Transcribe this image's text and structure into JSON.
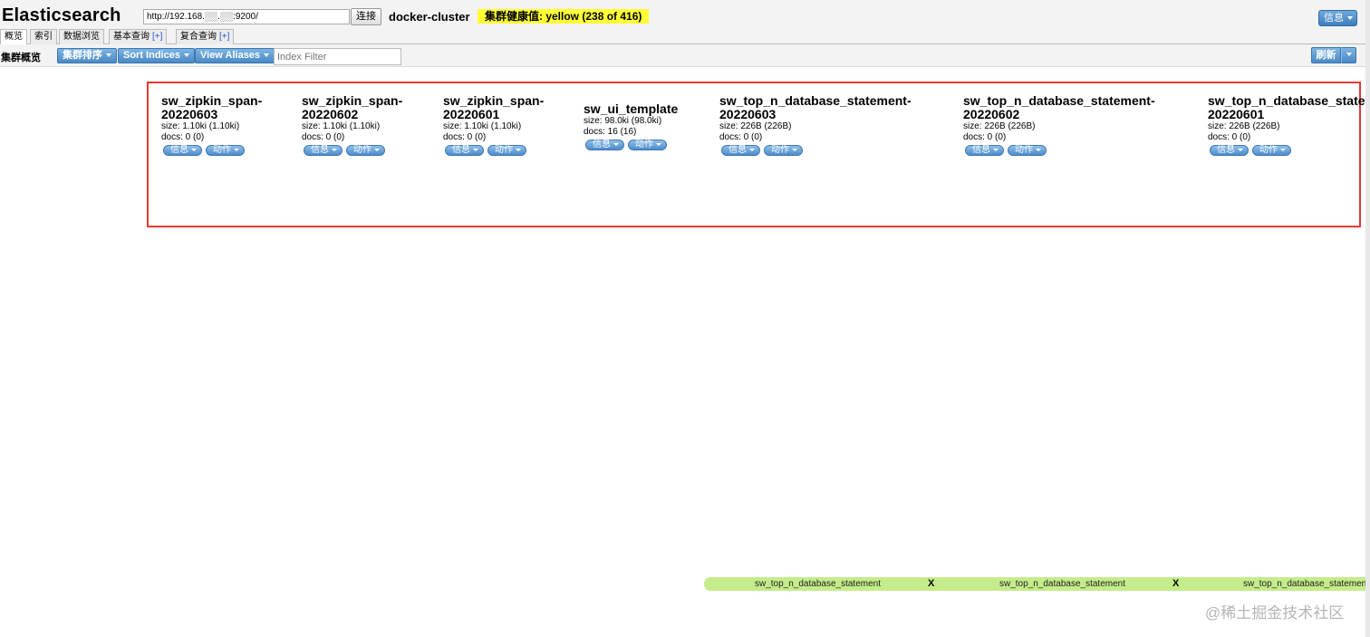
{
  "header": {
    "title": "Elasticsearch",
    "connect_url": "http://192.168.░░.░░:9200/",
    "connect_label": "连接",
    "cluster_name": "docker-cluster",
    "health": "集群健康值: yellow (238 of 416)",
    "info_label": "信息"
  },
  "tabs": [
    {
      "label": "概览",
      "active": true
    },
    {
      "label": "索引"
    },
    {
      "label": "数据浏览"
    },
    {
      "label": "基本查询",
      "plus": "[+]"
    },
    {
      "label": "复合查询",
      "plus": "[+]"
    }
  ],
  "toolbar": {
    "label": "集群概览",
    "sort_cluster": "集群排序",
    "sort_indices": "Sort Indices",
    "view_aliases": "View Aliases",
    "filter_placeholder": "Index Filter",
    "refresh": "刷新"
  },
  "indices": [
    {
      "line1": "sw_zipkin_span-",
      "line2": "20220603",
      "size": "size: 1.10ki (1.10ki)",
      "docs": "docs: 0 (0)",
      "info": "信息",
      "action": "动作"
    },
    {
      "line1": "sw_zipkin_span-",
      "line2": "20220602",
      "size": "size: 1.10ki (1.10ki)",
      "docs": "docs: 0 (0)",
      "info": "信息",
      "action": "动作"
    },
    {
      "line1": "sw_zipkin_span-",
      "line2": "20220601",
      "size": "size: 1.10ki (1.10ki)",
      "docs": "docs: 0 (0)",
      "info": "信息",
      "action": "动作"
    },
    {
      "line1": "sw_ui_template",
      "line2": "",
      "size": "size: 98.0ki (98.0ki)",
      "docs": "docs: 16 (16)",
      "info": "信息",
      "action": "动作"
    },
    {
      "line1": "sw_top_n_database_statement-",
      "line2": "20220603",
      "size": "size: 226B (226B)",
      "docs": "docs: 0 (0)",
      "info": "信息",
      "action": "动作"
    },
    {
      "line1": "sw_top_n_database_statement-",
      "line2": "20220602",
      "size": "size: 226B (226B)",
      "docs": "docs: 0 (0)",
      "info": "信息",
      "action": "动作"
    },
    {
      "line1": "sw_top_n_database_statement-",
      "line2": "20220601",
      "size": "size: 226B (226B)",
      "docs": "docs: 0 (0)",
      "info": "信息",
      "action": "动作"
    }
  ],
  "aliases": [
    "sw_top_n_database_statement",
    "sw_top_n_database_statement",
    "sw_top_n_database_statement"
  ],
  "alias_close": "X",
  "watermark": "@稀土掘金技术社区",
  "colors": {
    "health": "#ffff33",
    "button": "#4a89c6",
    "alias_bar": "#c4ec8a",
    "highlight": "#e53935"
  }
}
